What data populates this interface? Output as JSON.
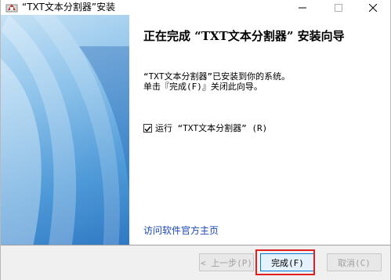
{
  "window": {
    "title": "“TXT文本分割器”安装"
  },
  "wizard": {
    "heading": "正在完成 “TXT文本分割器” 安装向导",
    "message_line1": "“TXT文本分割器”已安装到你的系统。",
    "message_line2": "单击『完成(F)』关闭此向导。",
    "run_label": "运行 “TXT文本分割器” (R)",
    "run_checked": true,
    "visit_link": "访问软件官方主页"
  },
  "footer": {
    "back_label": "< 上一步(P)",
    "finish_label": "完成(F)",
    "cancel_label": "取消(C)"
  },
  "colors": {
    "link": "#1a47b8",
    "highlight": "#e02020",
    "panel_dark": "#2f78c4",
    "panel_light": "#c6e2f6"
  },
  "icons": {
    "app": "installer-icon",
    "minimize": "minimize-icon",
    "maximize": "maximize-icon",
    "close": "close-icon",
    "check": "check-icon"
  }
}
